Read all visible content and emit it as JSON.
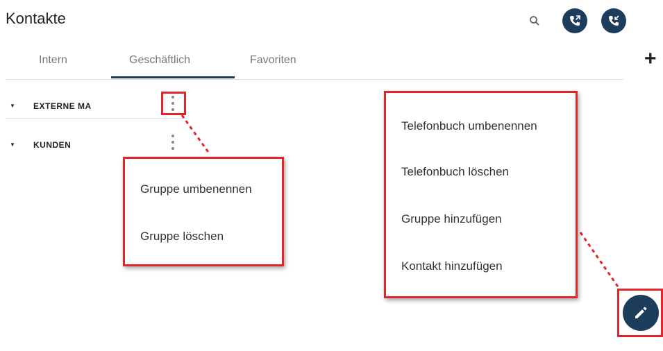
{
  "header": {
    "title": "Kontakte",
    "icons": [
      "search-icon",
      "phone-forward-icon",
      "phone-callback-icon",
      "add-icon"
    ]
  },
  "tabs": [
    {
      "label": "Intern"
    },
    {
      "label": "Geschäftlich",
      "active": true
    },
    {
      "label": "Favoriten"
    }
  ],
  "groups": [
    {
      "label": "EXTERNE MA"
    },
    {
      "label": "KUNDEN"
    }
  ],
  "group_menu": {
    "items": [
      {
        "label": "Gruppe umbenennen"
      },
      {
        "label": "Gruppe löschen"
      }
    ]
  },
  "fab_menu": {
    "items": [
      {
        "label": "Telefonbuch umbenennen"
      },
      {
        "label": "Telefonbuch löschen"
      },
      {
        "label": "Gruppe hinzufügen"
      },
      {
        "label": "Kontakt hinzufügen"
      }
    ]
  },
  "colors": {
    "primary": "#1c3d5c",
    "highlight": "#e2242b"
  }
}
